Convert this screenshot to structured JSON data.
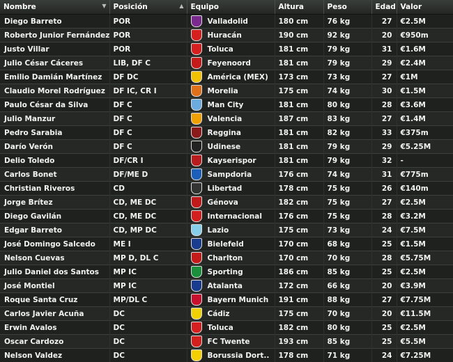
{
  "headers": {
    "nombre": "Nombre",
    "posicion": "Posición",
    "equipo": "Equipo",
    "altura": "Altura",
    "peso": "Peso",
    "edad": "Edad",
    "valor": "Valor"
  },
  "players": [
    {
      "name": "Diego Barreto",
      "pos": "POR",
      "club": "Valladolid",
      "height": "180 cm",
      "weight": "76 kg",
      "age": "27",
      "value": "€2.5M",
      "crest": "#7a2a8f"
    },
    {
      "name": "Roberto Junior Fernández",
      "pos": "POR",
      "club": "Huracán",
      "height": "190 cm",
      "weight": "92 kg",
      "age": "20",
      "value": "€950m",
      "crest": "#d62020"
    },
    {
      "name": "Justo Villar",
      "pos": "POR",
      "club": "Toluca",
      "height": "181 cm",
      "weight": "79 kg",
      "age": "31",
      "value": "€1.6M",
      "crest": "#d61f1f"
    },
    {
      "name": "Julio César Cáceres",
      "pos": "LIB, DF C",
      "club": "Feyenoord",
      "height": "181 cm",
      "weight": "79 kg",
      "age": "29",
      "value": "€2.4M",
      "crest": "#c41a1a"
    },
    {
      "name": "Emilio Damián Martínez",
      "pos": "DF DC",
      "club": "América (MEX)",
      "height": "173 cm",
      "weight": "73 kg",
      "age": "27",
      "value": "€1M",
      "crest": "#f2c200"
    },
    {
      "name": "Claudio Morel Rodríguez",
      "pos": "DF IC, CR I",
      "club": "Morelia",
      "height": "175 cm",
      "weight": "74 kg",
      "age": "30",
      "value": "€1.5M",
      "crest": "#e0701a"
    },
    {
      "name": "Paulo César da Silva",
      "pos": "DF C",
      "club": "Man City",
      "height": "181 cm",
      "weight": "80 kg",
      "age": "28",
      "value": "€3.6M",
      "crest": "#6cabdd"
    },
    {
      "name": "Julio Manzur",
      "pos": "DF C",
      "club": "Valencia",
      "height": "187 cm",
      "weight": "83 kg",
      "age": "27",
      "value": "€1.4M",
      "crest": "#f0a000"
    },
    {
      "name": "Pedro Sarabia",
      "pos": "DF C",
      "club": "Reggina",
      "height": "181 cm",
      "weight": "82 kg",
      "age": "33",
      "value": "€375m",
      "crest": "#8b1a1a"
    },
    {
      "name": "Darío Verón",
      "pos": "DF C",
      "club": "Udinese",
      "height": "181 cm",
      "weight": "79 kg",
      "age": "29",
      "value": "€5.25M",
      "crest": "#222222"
    },
    {
      "name": "Delio Toledo",
      "pos": "DF/CR I",
      "club": "Kayserispor",
      "height": "181 cm",
      "weight": "79 kg",
      "age": "32",
      "value": "-",
      "crest": "#b81c1c"
    },
    {
      "name": "Carlos Bonet",
      "pos": "DF/ME D",
      "club": "Sampdoria",
      "height": "176 cm",
      "weight": "74 kg",
      "age": "31",
      "value": "€775m",
      "crest": "#1c5fb8"
    },
    {
      "name": "Christian Riveros",
      "pos": "CD",
      "club": "Libertad",
      "height": "178 cm",
      "weight": "75 kg",
      "age": "26",
      "value": "€140m",
      "crest": "#333333"
    },
    {
      "name": "Jorge Brítez",
      "pos": "CD, ME DC",
      "club": "Génova",
      "height": "182 cm",
      "weight": "75 kg",
      "age": "27",
      "value": "€2.5M",
      "crest": "#c01a1a"
    },
    {
      "name": "Diego Gavilán",
      "pos": "CD, ME DC",
      "club": "Internacional",
      "height": "176 cm",
      "weight": "75 kg",
      "age": "28",
      "value": "€3.2M",
      "crest": "#d41f1f"
    },
    {
      "name": "Edgar Barreto",
      "pos": "CD, MP DC",
      "club": "Lazio",
      "height": "175 cm",
      "weight": "73 kg",
      "age": "24",
      "value": "€7.5M",
      "crest": "#87ceeb"
    },
    {
      "name": "José Domingo Salcedo",
      "pos": "ME I",
      "club": "Bielefeld",
      "height": "170 cm",
      "weight": "68 kg",
      "age": "25",
      "value": "€1.5M",
      "crest": "#1a3c8f"
    },
    {
      "name": "Nelson Cuevas",
      "pos": "MP D, DL C",
      "club": "Charlton",
      "height": "170 cm",
      "weight": "70 kg",
      "age": "28",
      "value": "€5.75M",
      "crest": "#c41a1a"
    },
    {
      "name": "Julio Daniel dos Santos",
      "pos": "MP IC",
      "club": "Sporting",
      "height": "186 cm",
      "weight": "85 kg",
      "age": "25",
      "value": "€2.5M",
      "crest": "#1a8f3c"
    },
    {
      "name": "José Montiel",
      "pos": "MP IC",
      "club": "Atalanta",
      "height": "172 cm",
      "weight": "66 kg",
      "age": "20",
      "value": "€3.9M",
      "crest": "#1a3c8f"
    },
    {
      "name": "Roque Santa Cruz",
      "pos": "MP/DL C",
      "club": "Bayern Munich",
      "height": "191 cm",
      "weight": "88 kg",
      "age": "27",
      "value": "€7.75M",
      "crest": "#c8102e"
    },
    {
      "name": "Carlos Javier Acuña",
      "pos": "DC",
      "club": "Cádiz",
      "height": "175 cm",
      "weight": "70 kg",
      "age": "20",
      "value": "€11.5M",
      "crest": "#f0d000"
    },
    {
      "name": "Erwin Avalos",
      "pos": "DC",
      "club": "Toluca",
      "height": "182 cm",
      "weight": "80 kg",
      "age": "25",
      "value": "€2.5M",
      "crest": "#d61f1f"
    },
    {
      "name": "Oscar Cardozo",
      "pos": "DC",
      "club": "FC Twente",
      "height": "193 cm",
      "weight": "85 kg",
      "age": "25",
      "value": "€5.5M",
      "crest": "#d41f1f"
    },
    {
      "name": "Nelson Valdez",
      "pos": "DC",
      "club": "Borussia Dort..",
      "height": "178 cm",
      "weight": "71 kg",
      "age": "24",
      "value": "€7.25M",
      "crest": "#f5d000"
    }
  ]
}
